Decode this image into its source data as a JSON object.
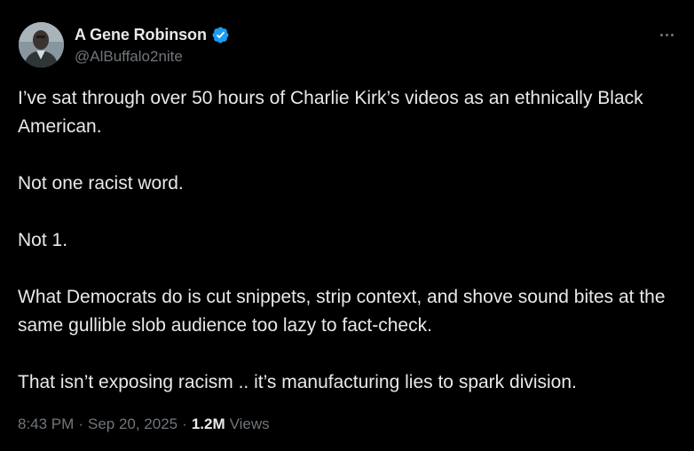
{
  "author": {
    "display_name": "A Gene Robinson",
    "handle": "@AlBuffalo2nite",
    "verified": true,
    "verified_color": "#1d9bf0",
    "avatar_icon": "avatar-photo"
  },
  "more_icon": "more-horizontal-icon",
  "tweet": {
    "paragraphs": [
      "I’ve sat through over 50 hours of Charlie Kirk’s videos as an ethnically Black American.",
      "Not one racist word.",
      "Not 1.",
      "What Democrats do is cut snippets, strip context, and shove sound bites at the same gullible slob audience too lazy to fact-check.",
      "That isn’t exposing racism .. it’s manufacturing lies to spark division."
    ]
  },
  "meta": {
    "time": "8:43 PM",
    "separator": "·",
    "date": "Sep 20, 2025",
    "views_count": "1.2M",
    "views_label": "Views"
  },
  "colors": {
    "background": "#000000",
    "primary_text": "#e7e9ea",
    "secondary_text": "#71767b"
  }
}
